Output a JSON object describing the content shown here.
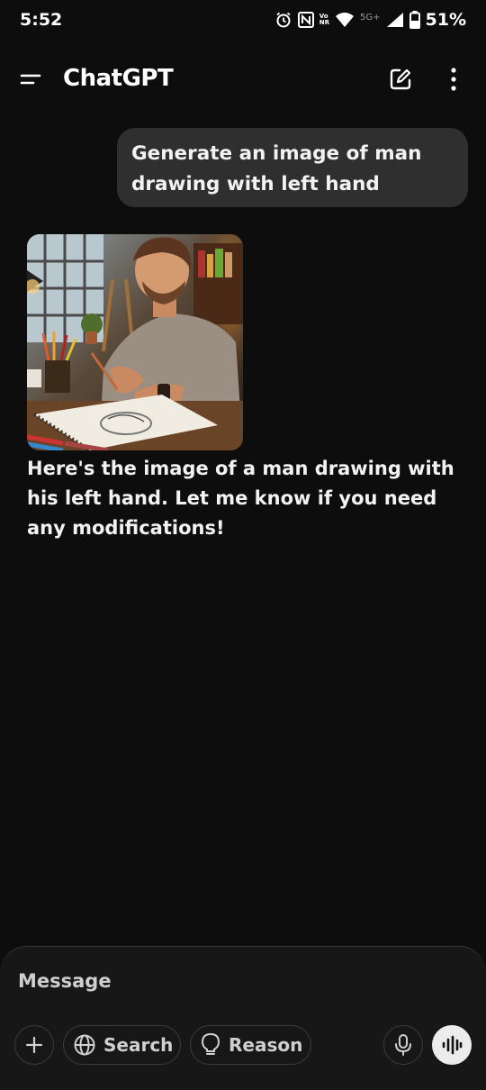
{
  "status_bar": {
    "time": "5:52",
    "volte_top": "Vo",
    "volte_bottom": "NR",
    "network_type": "5G+",
    "battery": "51%",
    "icons": [
      "alarm-icon",
      "nfc-icon",
      "volte-icon",
      "wifi-icon",
      "signal-icon",
      "battery-icon"
    ]
  },
  "header": {
    "title": "ChatGPT",
    "icons": [
      "menu-icon",
      "new-chat-icon",
      "more-vertical-icon"
    ]
  },
  "conversation": {
    "user_message": "Generate an image of man drawing with left hand",
    "assistant_image_subject": "man-drawing-sketchbook-image",
    "assistant_message": "Here's the image of a man drawing with his left hand. Let me know if you need any modifications!"
  },
  "composer": {
    "placeholder": "Message",
    "search_label": "Search",
    "reason_label": "Reason",
    "icons": [
      "plus-icon",
      "globe-icon",
      "lightbulb-icon",
      "mic-icon",
      "voice-mode-icon"
    ]
  },
  "colors": {
    "background": "#0d0d0d",
    "bubble": "#2f2f2f",
    "composer": "#171717",
    "voice_button": "#ececec"
  }
}
